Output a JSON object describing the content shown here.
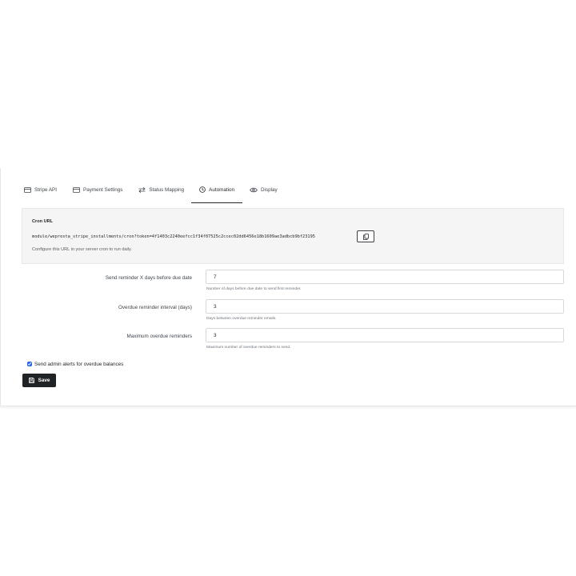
{
  "tabs": [
    {
      "label": "Stripe API",
      "icon": "credit-card-icon",
      "active": false
    },
    {
      "label": "Payment Settings",
      "icon": "credit-card-icon",
      "active": false
    },
    {
      "label": "Status Mapping",
      "icon": "arrows-swap-icon",
      "active": false
    },
    {
      "label": "Automation",
      "icon": "clock-icon",
      "active": true
    },
    {
      "label": "Display",
      "icon": "eye-icon",
      "active": false
    }
  ],
  "cron": {
    "title": "Cron URL",
    "url": "module/wepresta_stripe_installments/cron?token=4f1403c2240eefcc1f34f07525c2ccec02dd6456e18b1609ae3adbcb9bf23195",
    "help": "Configure this URL in your server cron to run daily."
  },
  "fields": [
    {
      "label": "Send reminder X days before due date",
      "value": "7",
      "help": "Number of days before due date to send first reminder."
    },
    {
      "label": "Overdue reminder interval (days)",
      "value": "3",
      "help": "Days between overdue reminder emails."
    },
    {
      "label": "Maximum overdue reminders",
      "value": "3",
      "help": "Maximum number of overdue reminders to send."
    }
  ],
  "admin_alerts": {
    "label": "Send admin alerts for overdue balances",
    "checked": true
  },
  "save_label": "Save",
  "colors": {
    "accent": "#1f2326",
    "checkbox": "#2563eb",
    "cron_bg": "#f5f5f5"
  }
}
